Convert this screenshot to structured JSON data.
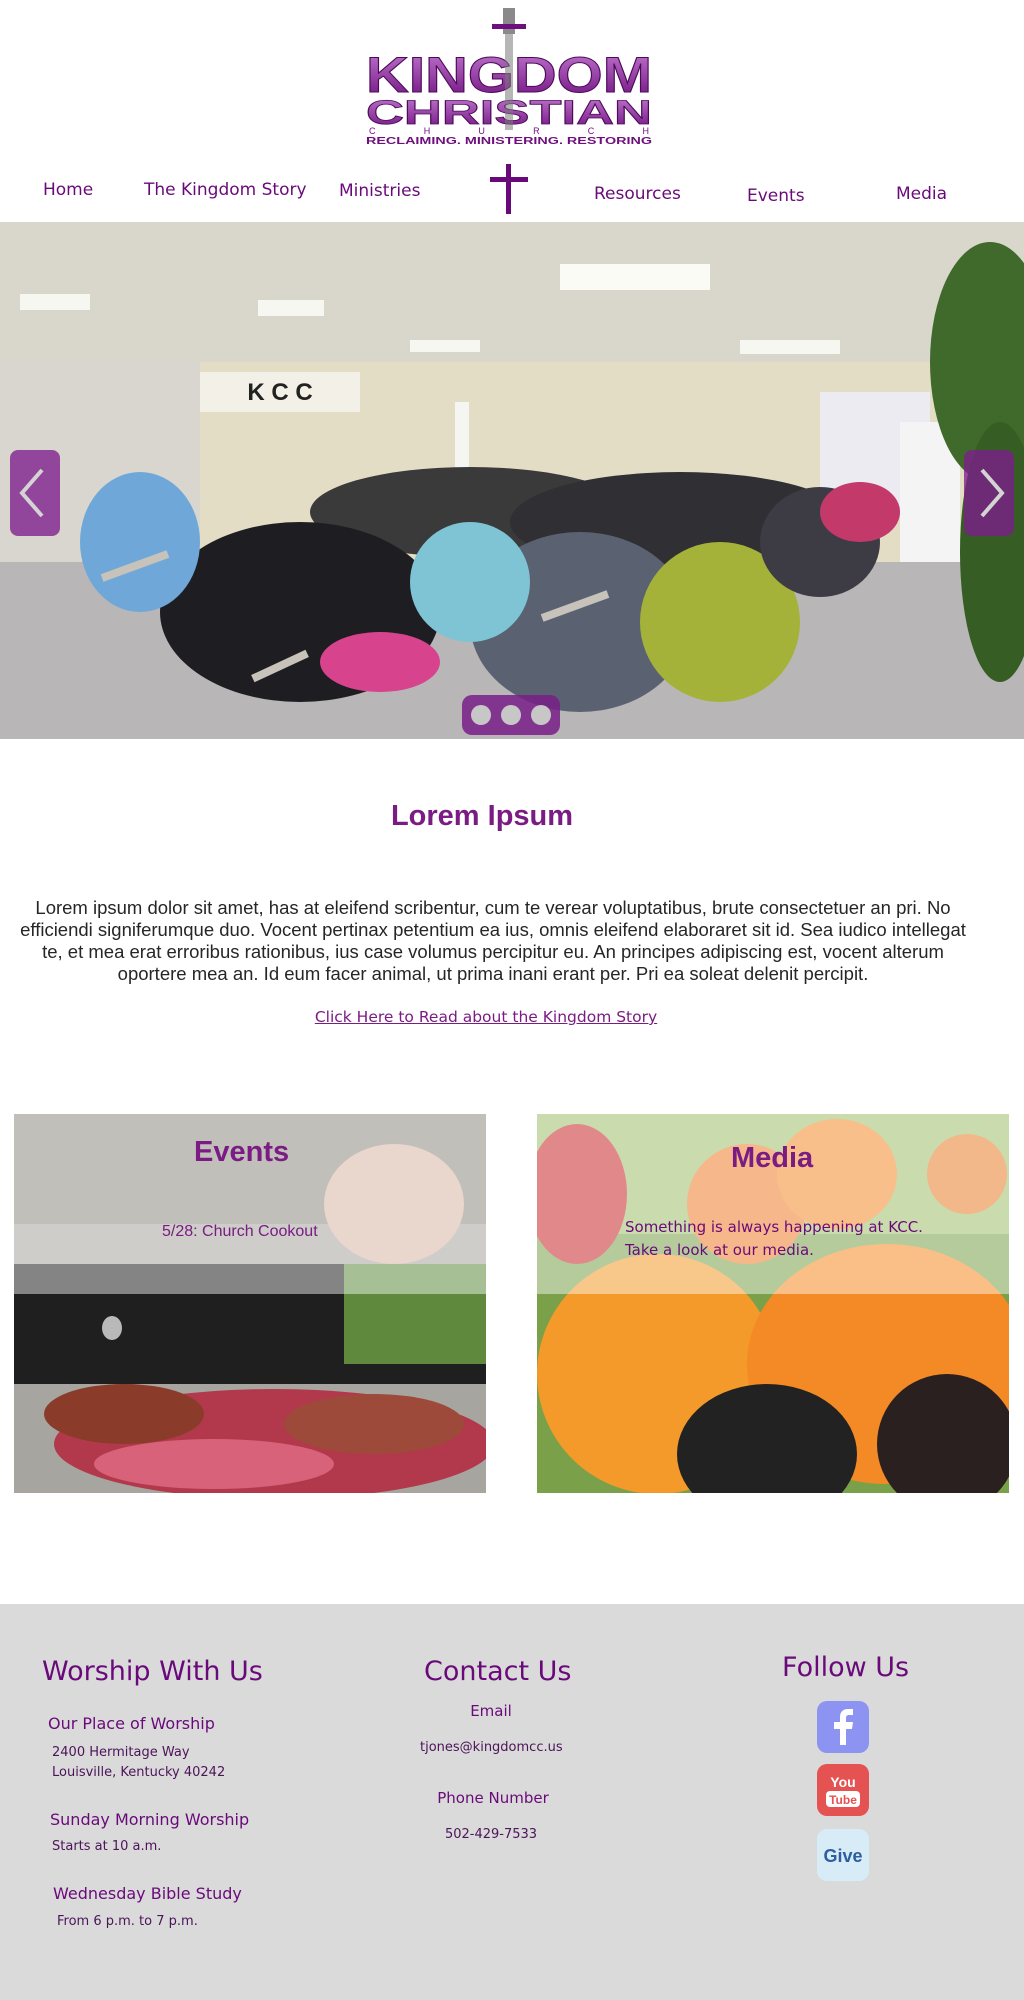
{
  "header": {
    "logo_text": [
      "KINGDOM",
      "CHRISTIAN",
      "C H U R C H",
      "RECLAIMING, MINISTERING, RESTORING"
    ]
  },
  "nav": {
    "items": [
      {
        "label": "Home"
      },
      {
        "label": "The Kingdom Story"
      },
      {
        "label": "Ministries"
      },
      {
        "label": "Resources"
      },
      {
        "label": "Events"
      },
      {
        "label": "Media"
      }
    ]
  },
  "hero": {
    "wall_sign": "K C C",
    "slide_count": 3,
    "colors": {
      "accent": "#7a1c83"
    }
  },
  "intro": {
    "title": "Lorem Ipsum",
    "body": "Lorem ipsum dolor sit amet, has at eleifend scribentur, cum te verear voluptatibus, brute consectetuer an pri. No efficiendi signiferumque duo. Vocent pertinax petentium ea ius, omnis eleifend elaboraret sit id. Sea iudico intellegat te, et mea erat erroribus rationibus, ius case volumus percipitur eu. An principes adipiscing est, vocent alterum oportere mea an. Id eum facer animal, ut prima inani erant per. Pri ea soleat delenit percipit.",
    "link": "Click Here to Read about the Kingdom Story"
  },
  "cards": {
    "events": {
      "title": "Events",
      "item": "5/28: Church Cookout"
    },
    "media": {
      "title": "Media",
      "text_line1": "Something is always happening at KCC.",
      "text_line2": "Take a look at our media."
    }
  },
  "footer": {
    "worship": {
      "title": "Worship With Us",
      "place_label": "Our Place of Worship",
      "address_line1": "2400 Hermitage Way",
      "address_line2": "Louisville,  Kentucky   40242",
      "sunday_label": "Sunday Morning Worship",
      "sunday_time": "Starts at 10 a.m.",
      "wednesday_label": "Wednesday Bible Study",
      "wednesday_time": "From 6 p.m. to 7 p.m."
    },
    "contact": {
      "title": "Contact Us",
      "email_label": "Email",
      "email": "tjones@kingdomcc.us",
      "phone_label": "Phone Number",
      "phone": "502-429-7533"
    },
    "follow": {
      "title": "Follow Us",
      "youtube_text": [
        "You",
        "Tube"
      ],
      "give_text": "Give",
      "icons": [
        "facebook-icon",
        "youtube-icon",
        "give-icon"
      ]
    }
  },
  "colors": {
    "brand_purple": "#7a1c83",
    "footer_bg": "#dadada"
  }
}
